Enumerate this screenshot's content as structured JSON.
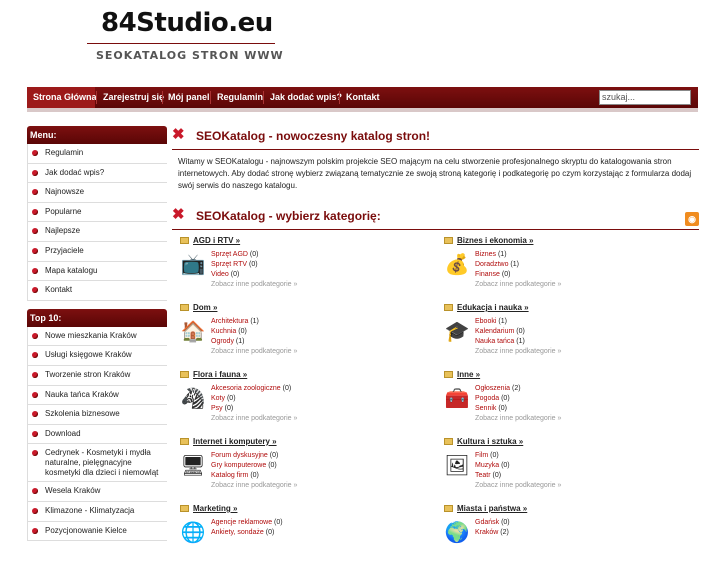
{
  "header": {
    "title": "84Studio.eu",
    "subtitle": "SEOKATALOG STRON WWW"
  },
  "nav": {
    "items": [
      "Strona Główna",
      "Zarejestruj się",
      "Mój panel",
      "Regulamin",
      "Jak dodać wpis?",
      "Kontakt"
    ],
    "search_placeholder": "szukaj..."
  },
  "sidebar": {
    "menu_title": "Menu:",
    "menu": [
      "Regulamin",
      "Jak dodać wpis?",
      "Najnowsze",
      "Popularne",
      "Najlepsze",
      "Przyjaciele",
      "Mapa katalogu",
      "Kontakt"
    ],
    "top_title": "Top 10:",
    "top": [
      "Nowe mieszkania Kraków",
      "Usługi księgowe Kraków",
      "Tworzenie stron Kraków",
      "Nauka tańca Kraków",
      "Szkolenia biznesowe",
      "Download",
      "Cedrynek - Kosmetyki i mydła naturalne, pielęgnacyjne kosmetyki dla dzieci i niemowląt",
      "Wesela Kraków",
      "Klimazone - Klimatyzacja",
      "Pozycjonowanie Kielce"
    ]
  },
  "main": {
    "title1": "SEOKatalog - nowoczesny katalog stron!",
    "intro": "Witamy w SEOKatalogu - najnowszym polskim projekcie SEO mającym na celu stworzenie profesjonalnego skryptu do katalogowania stron internetowych. Aby dodać stronę wybierz związaną tematycznie ze swoją stroną kategorię i podkategorię po czym korzystając z formularza dodaj swój serwis do naszego katalogu.",
    "title2": "SEOKatalog - wybierz kategorię:",
    "more_label": "Zobacz inne podkategorie »",
    "categories": [
      {
        "name": "AGD i RTV »",
        "icon": "tv-icon",
        "subs": [
          {
            "n": "Sprzęt AGD",
            "c": "(0)"
          },
          {
            "n": "Sprzęt RTV",
            "c": "(0)"
          },
          {
            "n": "Video",
            "c": "(0)"
          }
        ]
      },
      {
        "name": "Biznes i ekonomia »",
        "icon": "money-icon",
        "subs": [
          {
            "n": "Biznes",
            "c": "(1)"
          },
          {
            "n": "Doradztwo",
            "c": "(1)"
          },
          {
            "n": "Finanse",
            "c": "(0)"
          }
        ]
      },
      {
        "name": "Dom »",
        "icon": "house-icon",
        "subs": [
          {
            "n": "Architektura",
            "c": "(1)"
          },
          {
            "n": "Kuchnia",
            "c": "(0)"
          },
          {
            "n": "Ogrody",
            "c": "(1)"
          }
        ]
      },
      {
        "name": "Edukacja i nauka »",
        "icon": "graduation-cap-icon",
        "subs": [
          {
            "n": "Ebooki",
            "c": "(1)"
          },
          {
            "n": "Kalendarium",
            "c": "(0)"
          },
          {
            "n": "Nauka tańca",
            "c": "(1)"
          }
        ]
      },
      {
        "name": "Flora i fauna »",
        "icon": "zebra-icon",
        "subs": [
          {
            "n": "Akcesoria zoologiczne",
            "c": "(0)"
          },
          {
            "n": "Koty",
            "c": "(0)"
          },
          {
            "n": "Psy",
            "c": "(0)"
          }
        ]
      },
      {
        "name": "Inne »",
        "icon": "treasure-icon",
        "subs": [
          {
            "n": "Ogłoszenia",
            "c": "(2)"
          },
          {
            "n": "Pogoda",
            "c": "(0)"
          },
          {
            "n": "Sennik",
            "c": "(0)"
          }
        ]
      },
      {
        "name": "Internet i komputery »",
        "icon": "computer-icon",
        "subs": [
          {
            "n": "Forum dyskusyjne",
            "c": "(0)"
          },
          {
            "n": "Gry komputerowe",
            "c": "(0)"
          },
          {
            "n": "Katalog firm",
            "c": "(0)"
          }
        ]
      },
      {
        "name": "Kultura i sztuka »",
        "icon": "picture-icon",
        "subs": [
          {
            "n": "Film",
            "c": "(0)"
          },
          {
            "n": "Muzyka",
            "c": "(0)"
          },
          {
            "n": "Teatr",
            "c": "(0)"
          }
        ]
      },
      {
        "name": "Marketing »",
        "icon": "globe-icon",
        "subs": [
          {
            "n": "Agencje reklamowe",
            "c": "(0)"
          },
          {
            "n": "Ankiety, sondaże",
            "c": "(0)"
          }
        ]
      },
      {
        "name": "Miasta i państwa »",
        "icon": "earth-icon",
        "subs": [
          {
            "n": "Gdańsk",
            "c": "(0)"
          },
          {
            "n": "Kraków",
            "c": "(2)"
          }
        ]
      }
    ]
  },
  "colors": {
    "brand": "#7a0c0c",
    "link": "#b00c0c",
    "rss": "#f08c1f"
  }
}
